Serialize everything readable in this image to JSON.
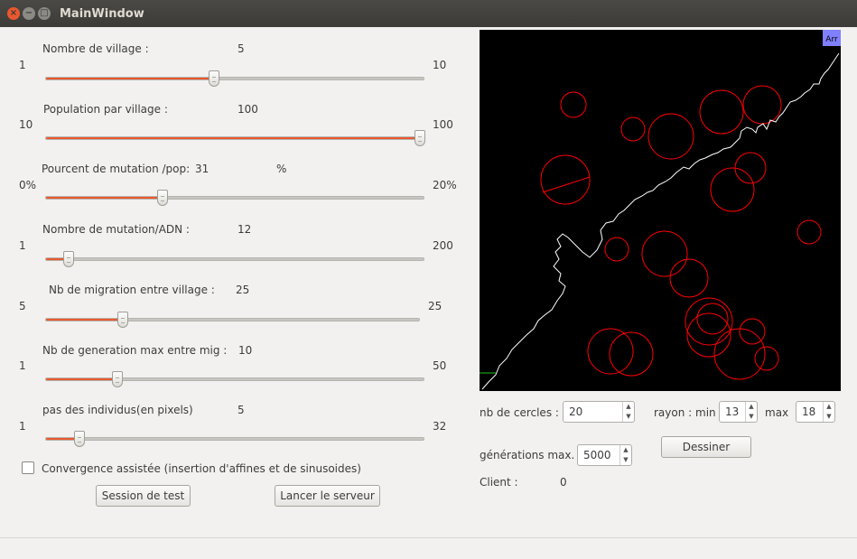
{
  "window": {
    "title": "MainWindow",
    "close": "×",
    "minimize": "−",
    "maximize": "□"
  },
  "sliders": [
    {
      "label": "Nombre de village :",
      "value": "5",
      "min": "1",
      "max": "10",
      "level": 0.44
    },
    {
      "label": "Population par village :",
      "value": "100",
      "min": "10",
      "max": "100",
      "level": 1.0
    },
    {
      "label": "Pourcent de mutation /pop:",
      "value": "31",
      "unit": "%",
      "min": "0%",
      "max": "20%",
      "level": 0.31
    },
    {
      "label": "Nombre de mutation/ADN :",
      "value": "12",
      "min": "1",
      "max": "200",
      "level": 0.06
    },
    {
      "label": "Nb de migration entre village :",
      "value": "25",
      "min": "5",
      "max": "25",
      "level": 0.2
    },
    {
      "label": "Nb de generation max entre mig :",
      "value": "10",
      "min": "1",
      "max": "50",
      "level": 0.18
    },
    {
      "label": "pas des individus(en pixels)",
      "value": "5",
      "min": "1",
      "max": "32",
      "level": 0.09
    }
  ],
  "convergence": {
    "label": "Convergence assistée (insertion d'affines et de sinusoides)",
    "checked": false
  },
  "buttons": {
    "test": "Session de test",
    "server": "Lancer le serveur",
    "draw": "Dessiner"
  },
  "canvas": {
    "arrival_label": "Arr"
  },
  "controls": {
    "circles_label": "nb de cercles :",
    "circles_value": "20",
    "radius_min_label": "rayon : min",
    "radius_min_value": "13",
    "radius_max_label": "max",
    "radius_max_value": "18",
    "gen_label": "générations max.",
    "gen_value": "5000"
  },
  "client": {
    "label": "Client :",
    "value": "0"
  },
  "colors": {
    "accent": "#e9592e",
    "circle": "#ff0000",
    "path": "#ffffff",
    "arrival": "#8080ff"
  }
}
